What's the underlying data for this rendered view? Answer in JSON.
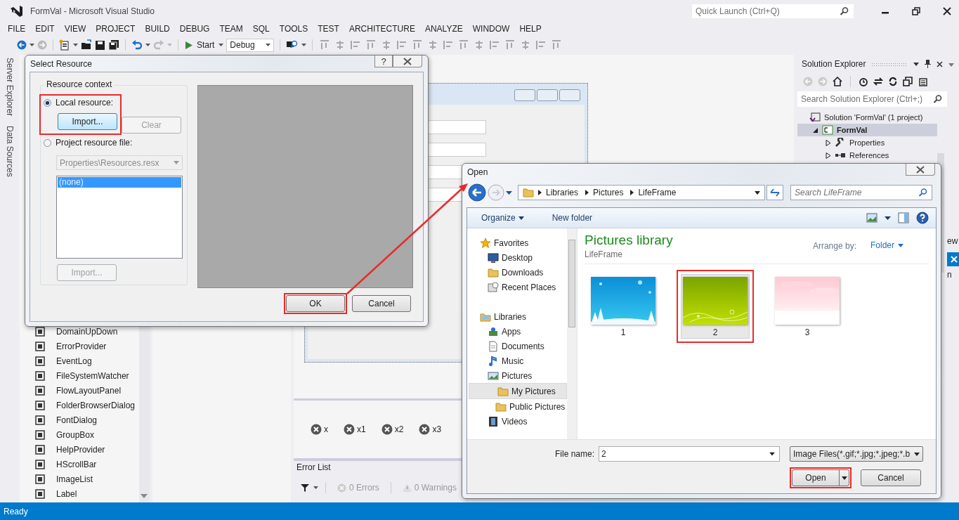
{
  "window": {
    "title": "FormVal - Microsoft Visual Studio",
    "quick_launch": {
      "placeholder": "Quick Launch (Ctrl+Q)"
    }
  },
  "menu": [
    "FILE",
    "EDIT",
    "VIEW",
    "PROJECT",
    "BUILD",
    "DEBUG",
    "TEAM",
    "SQL",
    "TOOLS",
    "TEST",
    "ARCHITECTURE",
    "ANALYZE",
    "WINDOW",
    "HELP"
  ],
  "toolbar": {
    "start": "Start",
    "configuration": "Debug"
  },
  "side_tabs": [
    "Server Explorer",
    "Data Sources"
  ],
  "toolbox": {
    "items": [
      "DomainUpDown",
      "ErrorProvider",
      "EventLog",
      "FileSystemWatcher",
      "FlowLayoutPanel",
      "FolderBrowserDialog",
      "FontDialog",
      "GroupBox",
      "HelpProvider",
      "HScrollBar",
      "ImageList",
      "Label"
    ]
  },
  "component_tray": [
    "x",
    "x1",
    "x2",
    "x3"
  ],
  "error_list": {
    "title": "Error List",
    "errors": "0 Errors",
    "warnings": "0 Warnings"
  },
  "solution_explorer": {
    "title": "Solution Explorer",
    "search": {
      "placeholder": "Search Solution Explorer (Ctrl+;)"
    },
    "tree": [
      {
        "label": "Solution 'FormVal' (1 project)",
        "kind": "solution",
        "selected": false,
        "children": [
          {
            "label": "FormVal",
            "kind": "project",
            "expanded": true,
            "selected": true,
            "children": [
              {
                "label": "Properties",
                "kind": "properties",
                "expanded": false,
                "selected": false
              },
              {
                "label": "References",
                "kind": "references",
                "expanded": false,
                "selected": false
              }
            ]
          }
        ]
      }
    ]
  },
  "side_fragments": [
    "ew",
    "n"
  ],
  "status_bar": "Ready",
  "select_resource": {
    "title": "Select Resource",
    "help": "?",
    "group": "Resource context",
    "options": [
      {
        "label": "Local resource:",
        "selected": true,
        "highlighted": true
      },
      {
        "label": "Project resource file:",
        "selected": false,
        "highlighted": false
      }
    ],
    "import": {
      "label": "Import...",
      "disabled": false
    },
    "clear": {
      "label": "Clear",
      "disabled": true
    },
    "resx": {
      "value": "Properties\\Resources.resx",
      "disabled": true
    },
    "resources": [
      {
        "label": "(none)",
        "selected": true
      }
    ],
    "import2": {
      "label": "Import...",
      "disabled": true
    },
    "ok": {
      "label": "OK",
      "highlighted": true
    },
    "cancel": {
      "label": "Cancel"
    }
  },
  "open_dialog": {
    "title": "Open",
    "path": [
      "Libraries",
      "Pictures",
      "LifeFrame"
    ],
    "search": {
      "placeholder": "Search LifeFrame"
    },
    "organize": "Organize",
    "new_folder": "New folder",
    "nav": [
      {
        "label": "Favorites",
        "kind": "star",
        "selected": false,
        "children": [
          {
            "label": "Desktop",
            "kind": "desktop",
            "selected": false
          },
          {
            "label": "Downloads",
            "kind": "folder",
            "selected": false
          },
          {
            "label": "Recent Places",
            "kind": "recent",
            "selected": false
          }
        ]
      },
      {
        "label": "Libraries",
        "kind": "library",
        "selected": false,
        "children": [
          {
            "label": "Apps",
            "kind": "apps",
            "selected": false
          },
          {
            "label": "Documents",
            "kind": "document",
            "selected": false
          },
          {
            "label": "Music",
            "kind": "music",
            "selected": false
          },
          {
            "label": "Pictures",
            "kind": "pictures",
            "selected": false,
            "children": [
              {
                "label": "My Pictures",
                "kind": "folder",
                "selected": true
              },
              {
                "label": "Public Pictures",
                "kind": "folder",
                "selected": false
              }
            ]
          },
          {
            "label": "Videos",
            "kind": "video",
            "selected": false
          }
        ]
      }
    ],
    "library_title": "Pictures library",
    "library_subtitle": "LifeFrame",
    "arrange_label": "Arrange by:",
    "arrange_value": "Folder",
    "files": [
      {
        "name": "1",
        "kind": "picture",
        "selected": false,
        "highlighted": false
      },
      {
        "name": "2",
        "kind": "picture",
        "selected": true,
        "highlighted": true
      },
      {
        "name": "3",
        "kind": "picture",
        "selected": false,
        "highlighted": false
      }
    ],
    "file_name_label": "File name:",
    "file_name": "2",
    "file_type": "Image Files(*.gif;*.jpg;*.jpeg;*.b",
    "open": {
      "label": "Open",
      "highlighted": true
    },
    "cancel": {
      "label": "Cancel"
    }
  }
}
